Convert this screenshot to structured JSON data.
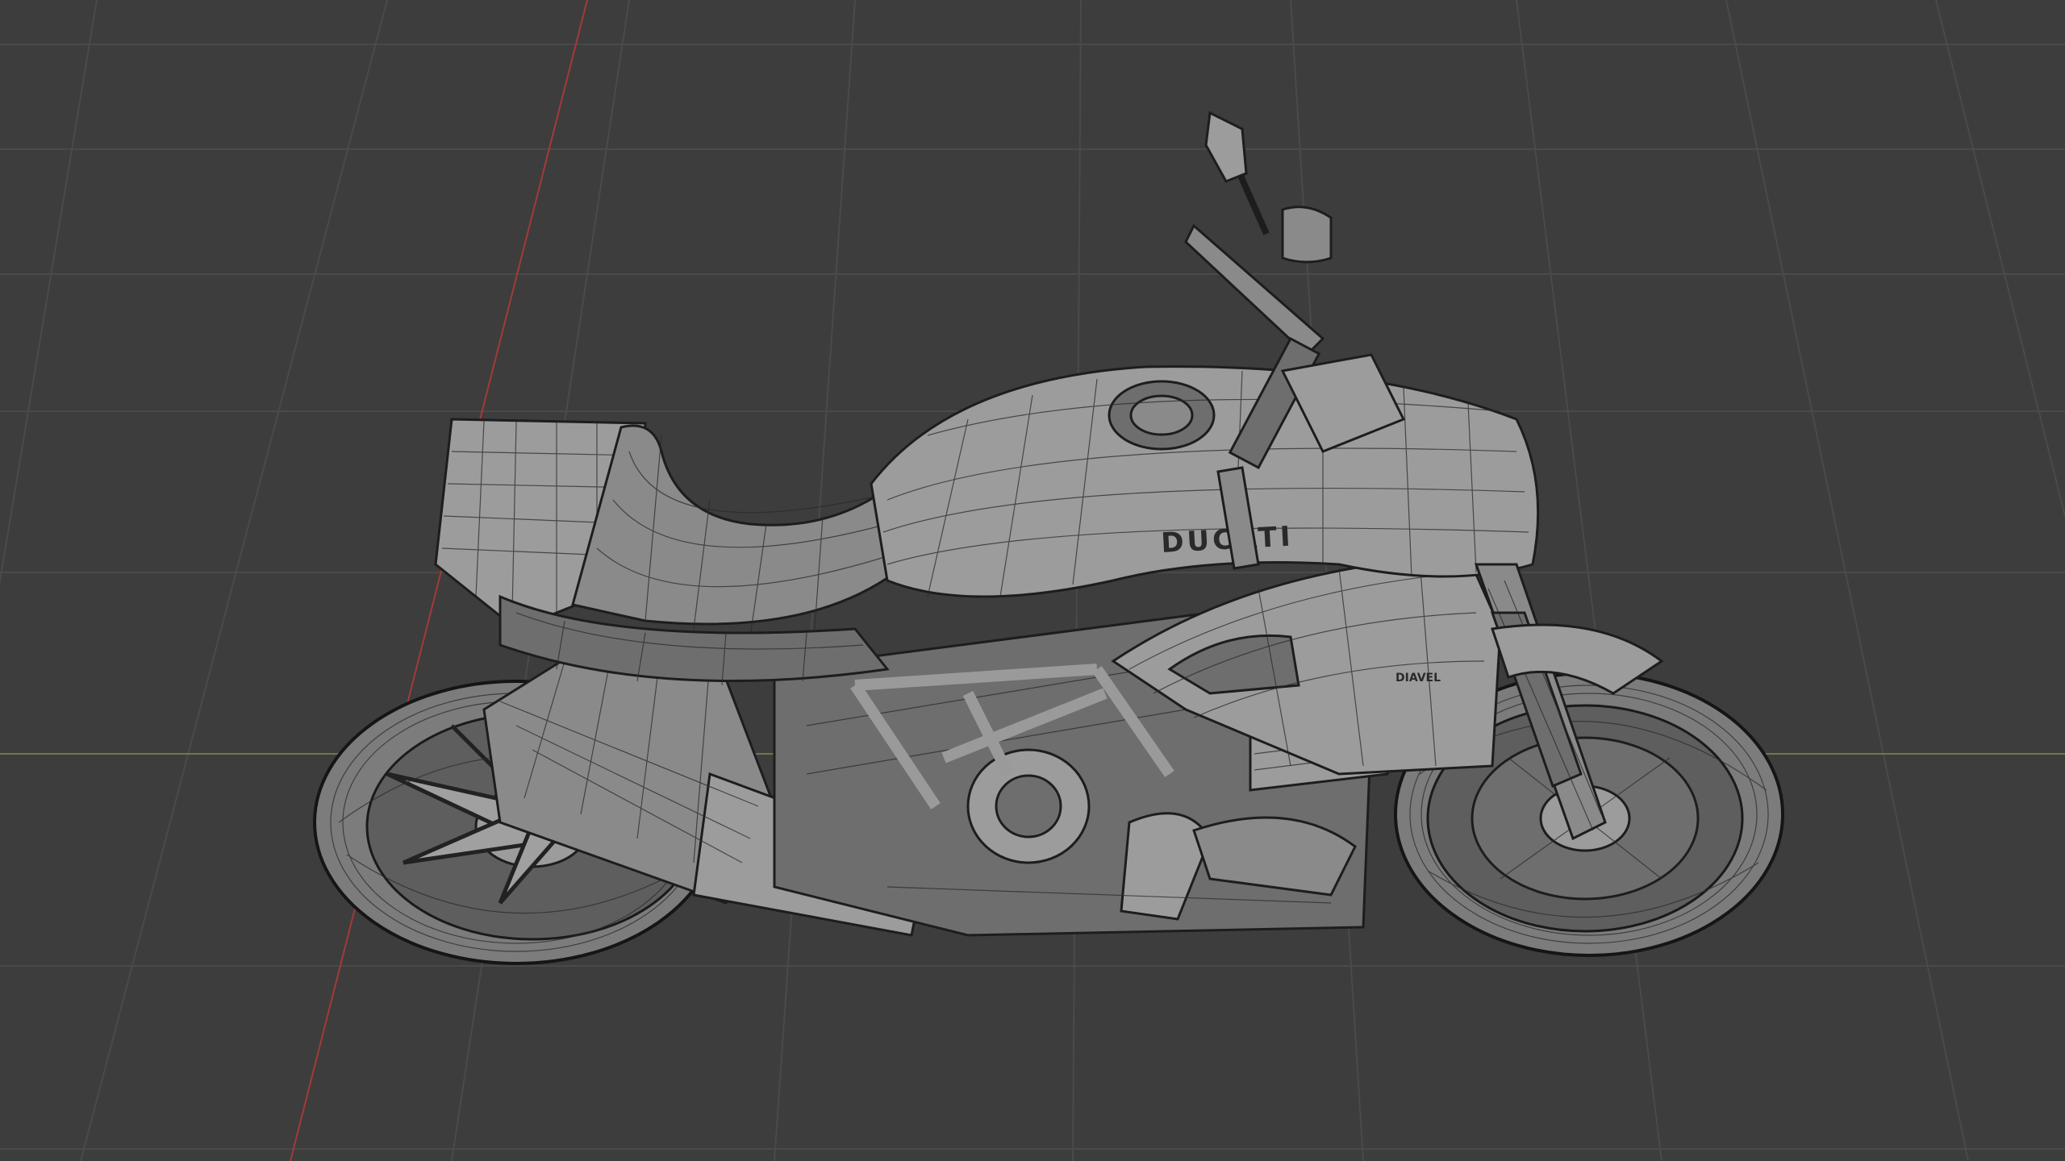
{
  "viewport": {
    "background": "#3d3d3d",
    "grid_color": "#4a4a4a",
    "x_axis_color": "#6b7a48",
    "y_axis_color": "#a23a3a",
    "shading_mode": "solid-wireframe"
  },
  "model": {
    "object": "motorcycle",
    "tank_logo": "DUCATI",
    "side_badge": "DIAVEL",
    "mesh_color": "#8a8a8a",
    "wire_color": "#2a2a2a"
  }
}
